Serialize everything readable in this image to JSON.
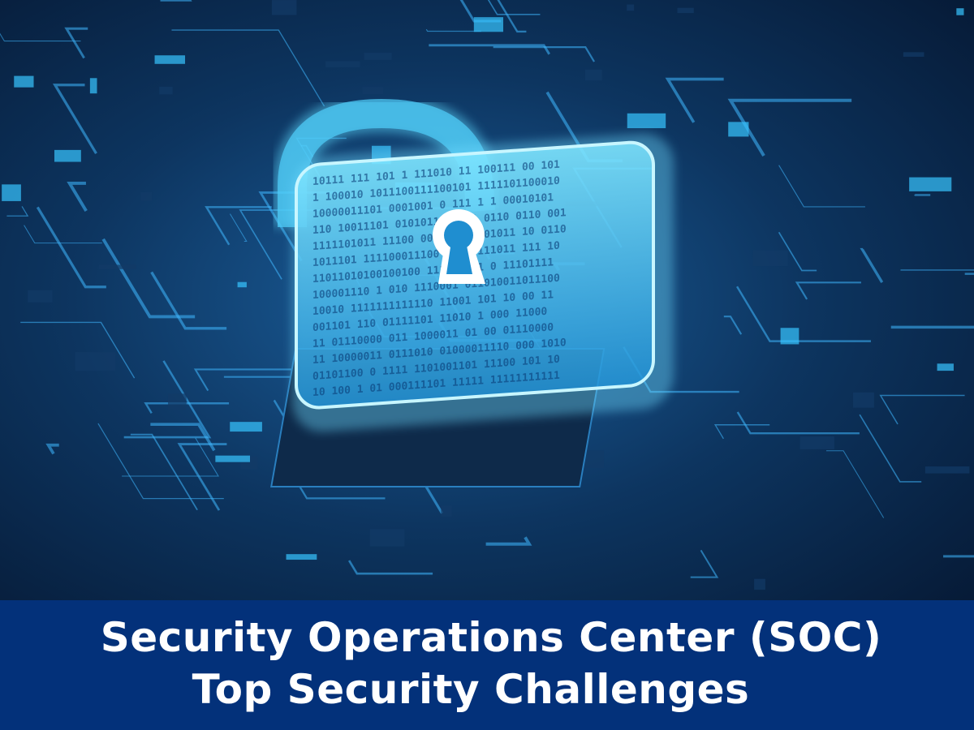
{
  "image": {
    "subject": "glowing padlock on circuit board",
    "icon": "padlock-icon",
    "colors": {
      "background": "#06142e",
      "glow": "#3fd0ff",
      "banner": "#03317a",
      "text": "#ffffff"
    }
  },
  "banner": {
    "line1": "Security Operations Center (SOC)",
    "line2": "Top Security Challenges"
  }
}
